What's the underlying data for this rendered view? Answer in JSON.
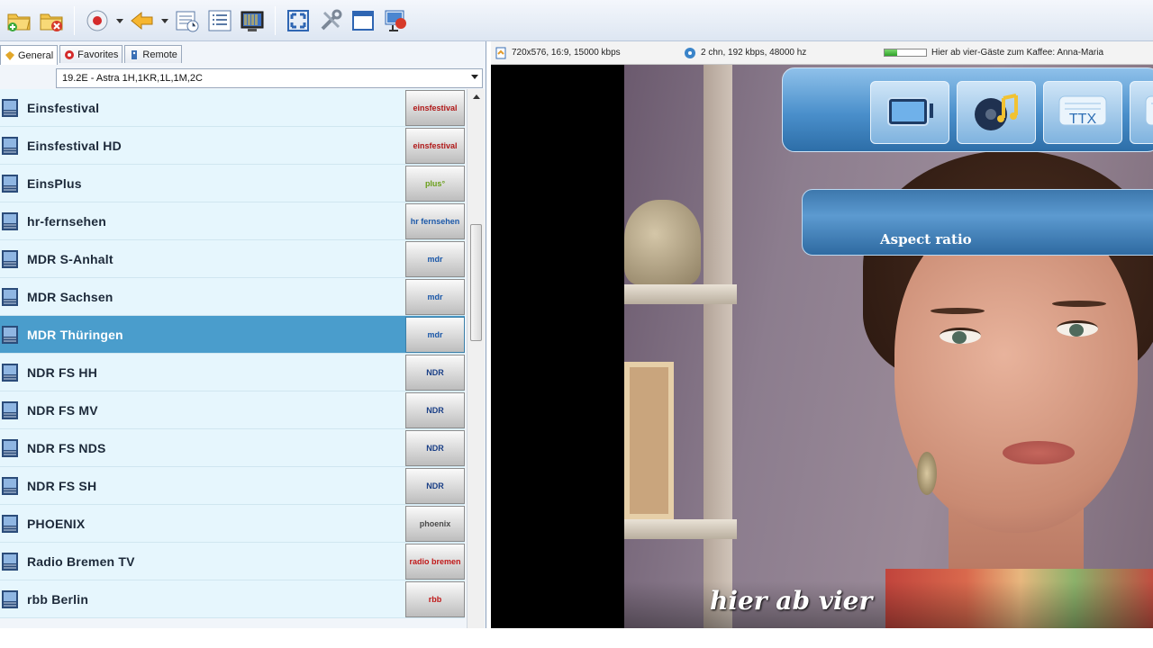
{
  "toolbar": {
    "icons": [
      "open-folder-icon",
      "close-folder-icon",
      "record-icon",
      "back-icon",
      "schedule-icon",
      "list-icon",
      "tv-icon",
      "fullscreen-icon",
      "settings-icon",
      "window-icon",
      "network-icon"
    ]
  },
  "tabs": [
    {
      "label": "General",
      "icon": "general-icon"
    },
    {
      "label": "Favorites",
      "icon": "favorites-icon"
    },
    {
      "label": "Remote",
      "icon": "remote-icon"
    }
  ],
  "satellite": {
    "selected": "19.2E -  Astra 1H,1KR,1L,1M,2C"
  },
  "channels": [
    {
      "name": "Einsfestival",
      "logo": "einsfestival",
      "selected": false
    },
    {
      "name": "Einsfestival HD",
      "logo": "einsfestival",
      "selected": false
    },
    {
      "name": "EinsPlus",
      "logo": "plus",
      "selected": false
    },
    {
      "name": "hr-fernsehen",
      "logo": "hr",
      "selected": false
    },
    {
      "name": "MDR S-Anhalt",
      "logo": "mdr",
      "selected": false
    },
    {
      "name": "MDR Sachsen",
      "logo": "mdr",
      "selected": false
    },
    {
      "name": "MDR Thüringen",
      "logo": "mdr",
      "selected": true
    },
    {
      "name": "NDR FS HH",
      "logo": "ndr",
      "selected": false
    },
    {
      "name": "NDR FS MV",
      "logo": "ndr",
      "selected": false
    },
    {
      "name": "NDR FS NDS",
      "logo": "ndr",
      "selected": false
    },
    {
      "name": "NDR FS SH",
      "logo": "ndr",
      "selected": false
    },
    {
      "name": "PHOENIX",
      "logo": "phoenix",
      "selected": false
    },
    {
      "name": "Radio Bremen TV",
      "logo": "rb",
      "selected": false
    },
    {
      "name": "rbb Berlin",
      "logo": "rbb",
      "selected": false
    }
  ],
  "status": {
    "video_info": "720x576, 16:9, 15000 kbps",
    "audio_info": "2 chn, 192 kbps, 48000 hz",
    "signal_level": 0.3,
    "program_title": "Hier ab vier-Gäste zum Kaffee: Anna-Maria"
  },
  "osd": {
    "buttons": [
      "screen-icon",
      "music-icon",
      "teletext-icon",
      "subtitle-icon"
    ],
    "ttx_label": "TTX",
    "panel_label": "Aspect ratio"
  },
  "video": {
    "caption": "hier ab vier"
  },
  "colors": {
    "selected_row": "#4a9dcc",
    "row_bg": "#e6f6fd",
    "osd_blue": "#4a8fcb"
  }
}
